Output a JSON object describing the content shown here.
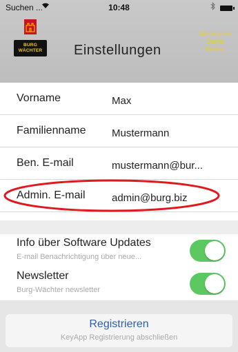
{
  "status_bar": {
    "carrier": "Suchen ...",
    "wifi": "wifi-icon",
    "time": "10:48",
    "bluetooth": "bluetooth-icon",
    "battery": "battery-icon"
  },
  "header": {
    "logo_text_1": "BURG",
    "logo_text_2": "WÄCHTER",
    "title": "Einstellungen",
    "demo_link": "Wechsel in Demo Modus",
    "demo_link_color": "#e8d21a"
  },
  "form": {
    "fields": [
      {
        "label": "Vorname",
        "value": "Max"
      },
      {
        "label": "Familienname",
        "value": "Mustermann"
      },
      {
        "label": "Ben. E-mail",
        "value": "mustermann@bur..."
      },
      {
        "label": "Admin. E-mail",
        "value": "admin@burg.biz"
      }
    ]
  },
  "toggles": [
    {
      "label": "Info über Software Updates",
      "subtitle": "E-mail Benachrichtigung über neue...",
      "on": true
    },
    {
      "label": "Newsletter",
      "subtitle": "Burg-Wächter newsletter",
      "on": true
    }
  ],
  "footer": {
    "register_label": "Registrieren",
    "register_subtitle": "KeyApp Registrierung abschließen",
    "link_color": "#2a5fb0",
    "switch_color": "#5cc860"
  },
  "annotation_color": "#e0191f"
}
